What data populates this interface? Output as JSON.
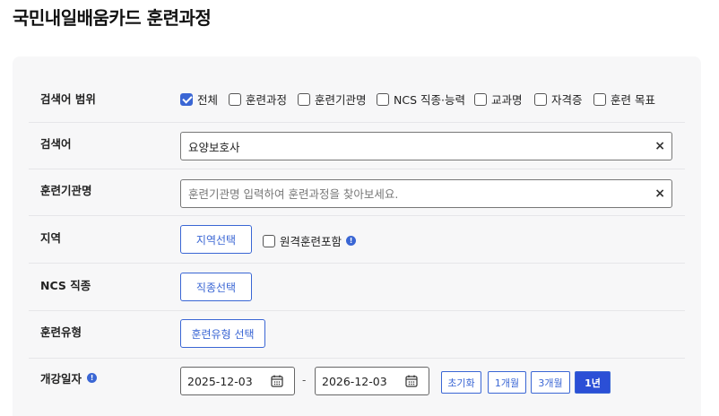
{
  "page": {
    "title": "국민내일배움카드 훈련과정"
  },
  "search_scope": {
    "label": "검색어 범위",
    "options": [
      {
        "label": "전체",
        "checked": true
      },
      {
        "label": "훈련과정",
        "checked": false
      },
      {
        "label": "훈련기관명",
        "checked": false
      },
      {
        "label": "NCS 직종·능력",
        "checked": false
      },
      {
        "label": "교과명",
        "checked": false
      },
      {
        "label": "자격증",
        "checked": false
      },
      {
        "label": "훈련 목표",
        "checked": false
      }
    ]
  },
  "keyword": {
    "label": "검색어",
    "value": "요양보호사",
    "clear": "×"
  },
  "institution": {
    "label": "훈련기관명",
    "value": "",
    "placeholder": "훈련기관명 입력하여 훈련과정을 찾아보세요.",
    "clear": "×"
  },
  "region": {
    "label": "지역",
    "button": "지역선택",
    "remote_label": "원격훈련포함",
    "remote_checked": false,
    "info": "!"
  },
  "ncs": {
    "label": "NCS 직종",
    "button": "직종선택"
  },
  "training_type": {
    "label": "훈련유형",
    "button": "훈련유형 선택"
  },
  "start_date": {
    "label": "개강일자",
    "info": "!",
    "from": "2025-12-03",
    "separator": "-",
    "to": "2026-12-03",
    "periods": [
      "초기화",
      "1개월",
      "3개월",
      "1년"
    ],
    "active_period": "1년"
  },
  "colors": {
    "accent": "#3a66d4",
    "active": "#2b4fd6",
    "panel": "#f7f7f8"
  }
}
